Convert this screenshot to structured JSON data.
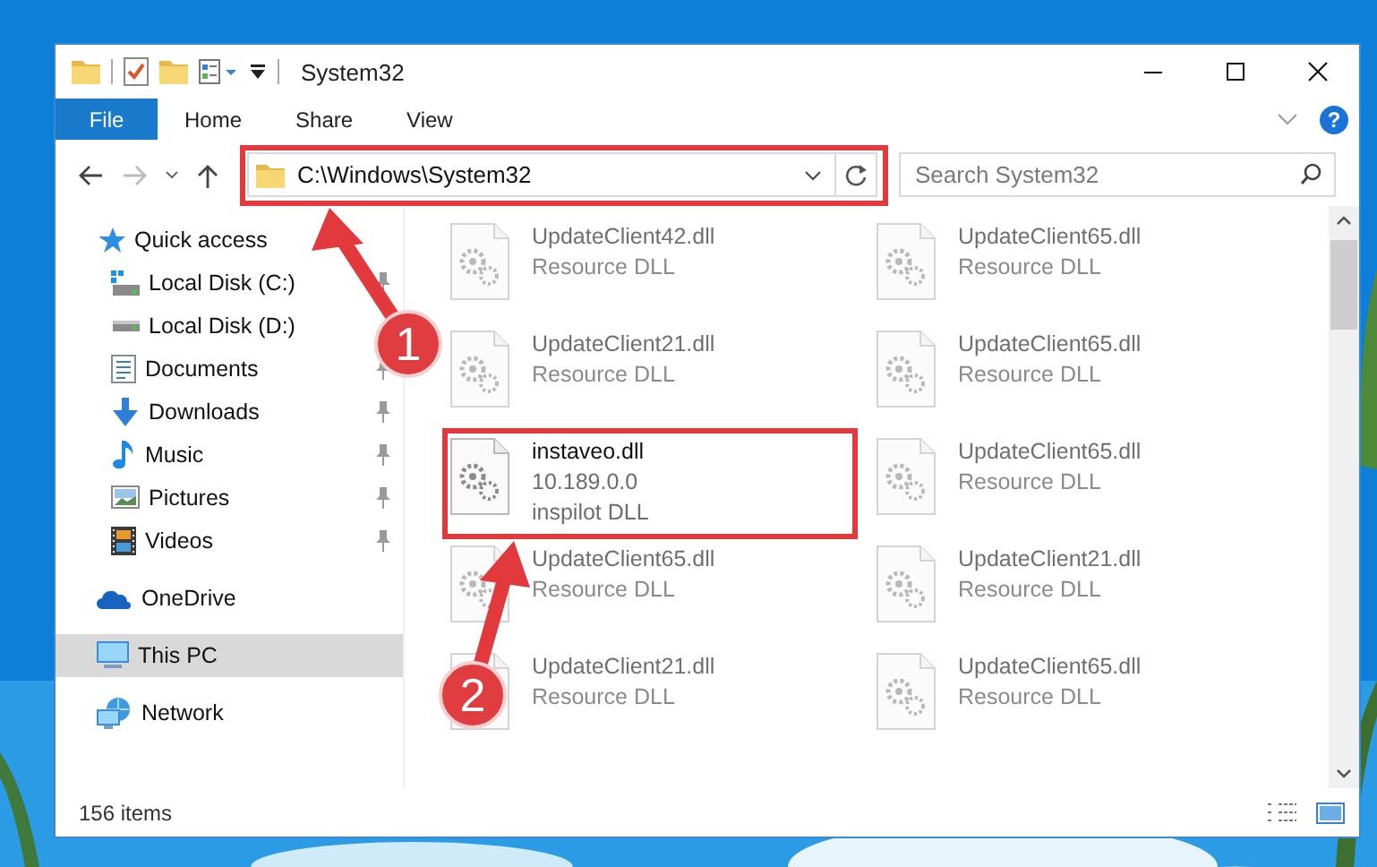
{
  "window": {
    "title": "System32"
  },
  "ribbon": {
    "tabs": [
      {
        "label": "File",
        "kind": "file"
      },
      {
        "label": "Home",
        "kind": "tab"
      },
      {
        "label": "Share",
        "kind": "tab"
      },
      {
        "label": "View",
        "kind": "tab"
      }
    ],
    "help": "?"
  },
  "address_bar": {
    "path": "C:\\Windows\\System32"
  },
  "search": {
    "placeholder": "Search System32"
  },
  "navigation": [
    {
      "label": "Quick access",
      "selected": false,
      "children": [
        {
          "label": "Local Disk (C:)",
          "pinned": true,
          "selected": false
        },
        {
          "label": "Local Disk (D:)",
          "pinned": false,
          "selected": false
        },
        {
          "label": "Documents",
          "pinned": true,
          "selected": false
        },
        {
          "label": "Downloads",
          "pinned": true,
          "selected": false
        },
        {
          "label": "Music",
          "pinned": true,
          "selected": false
        },
        {
          "label": "Pictures",
          "pinned": true,
          "selected": false
        },
        {
          "label": "Videos",
          "pinned": true,
          "selected": false
        }
      ]
    },
    {
      "label": "OneDrive",
      "selected": false
    },
    {
      "label": "This PC",
      "selected": true
    },
    {
      "label": "Network",
      "selected": false
    }
  ],
  "files": [
    {
      "name": "UpdateClient42.dll",
      "details": [
        "Resource DLL"
      ],
      "blurred": true
    },
    {
      "name": "UpdateClient65.dll",
      "details": [
        "Resource DLL"
      ],
      "blurred": true
    },
    {
      "name": "UpdateClient21.dll",
      "details": [
        "Resource DLL"
      ],
      "blurred": true
    },
    {
      "name": "UpdateClient65.dll",
      "details": [
        "Resource DLL"
      ],
      "blurred": true
    },
    {
      "name": "instaveo.dll",
      "details": [
        "10.189.0.0",
        "inspilot DLL"
      ],
      "blurred": false
    },
    {
      "name": "UpdateClient65.dll",
      "details": [
        "Resource DLL"
      ],
      "blurred": true
    },
    {
      "name": "UpdateClient65.dll",
      "details": [
        "Resource DLL"
      ],
      "blurred": true
    },
    {
      "name": "UpdateClient21.dll",
      "details": [
        "Resource DLL"
      ],
      "blurred": true
    },
    {
      "name": "UpdateClient21.dll",
      "details": [
        "Resource DLL"
      ],
      "blurred": true
    },
    {
      "name": "UpdateClient65.dll",
      "details": [
        "Resource DLL"
      ],
      "blurred": true
    }
  ],
  "status_bar": {
    "item_count": "156 items"
  },
  "annotations": [
    {
      "number": "1"
    },
    {
      "number": "2"
    }
  ]
}
